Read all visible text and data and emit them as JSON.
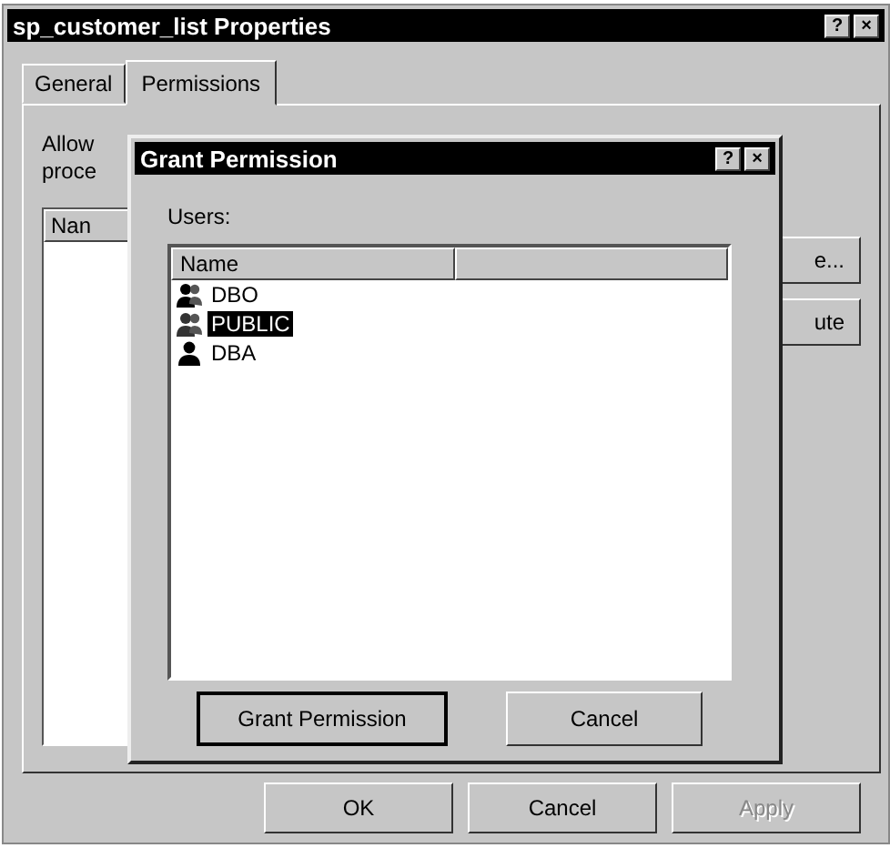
{
  "window": {
    "title": "sp_customer_list Properties",
    "title_buttons": [
      "?",
      "×"
    ]
  },
  "tabs": [
    {
      "label": "General",
      "selected": false
    },
    {
      "label": "Permissions",
      "selected": true
    }
  ],
  "panel": {
    "label_line_1": "Allow",
    "label_line_2": "proce",
    "list_header": "Nan",
    "side_buttons": [
      "e...",
      "ute"
    ]
  },
  "dialog": {
    "title": "Grant Permission",
    "title_buttons": [
      "?",
      "×"
    ],
    "users_label": "Users:",
    "columns": [
      "Name"
    ],
    "users": [
      {
        "name": "DBO",
        "kind": "group",
        "selected": false
      },
      {
        "name": "PUBLIC",
        "kind": "group",
        "selected": true
      },
      {
        "name": "DBA",
        "kind": "user",
        "selected": false
      }
    ],
    "buttons": [
      {
        "label": "Grant Permission",
        "default": true
      },
      {
        "label": "Cancel",
        "default": false
      }
    ]
  },
  "buttons": [
    {
      "label": "OK",
      "disabled": false
    },
    {
      "label": "Cancel",
      "disabled": false
    },
    {
      "label": "Apply",
      "disabled": true
    }
  ]
}
